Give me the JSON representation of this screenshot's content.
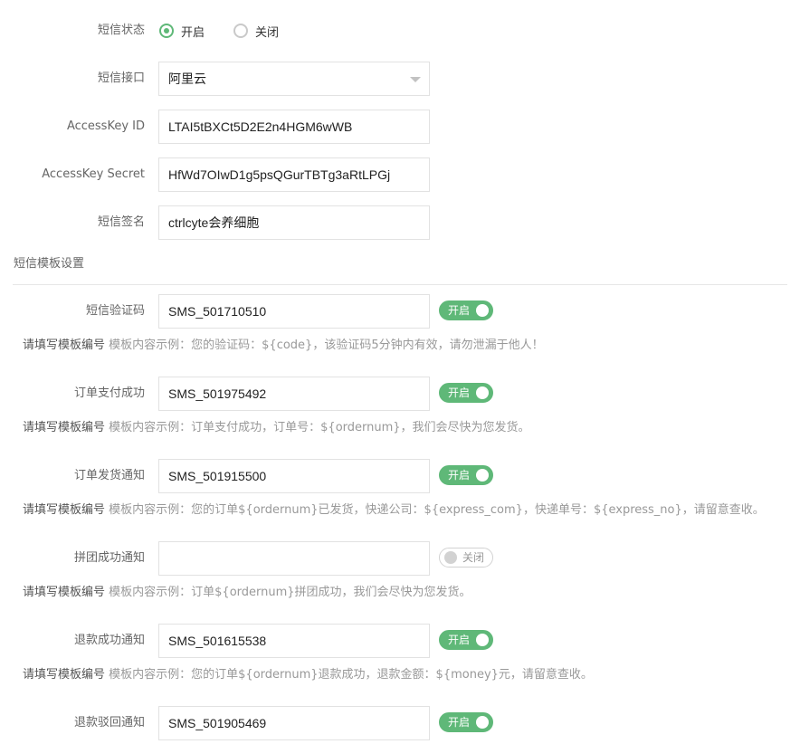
{
  "sms_status": {
    "label": "短信状态",
    "options": [
      {
        "label": "开启",
        "checked": true
      },
      {
        "label": "关闭",
        "checked": false
      }
    ]
  },
  "sms_provider": {
    "label": "短信接口",
    "value": "阿里云"
  },
  "access_key_id": {
    "label": "AccessKey ID",
    "value": "LTAI5tBXCt5D2E2n4HGM6wWB"
  },
  "access_key_secret": {
    "label": "AccessKey Secret",
    "value": "HfWd7OIwD1g5psQGurTBTg3aRtLPGj"
  },
  "sms_signature": {
    "label": "短信签名",
    "value": "ctrlcyte会养细胞"
  },
  "template_section_title": "短信模板设置",
  "hint_prefix": "请填写模板编号",
  "templates": [
    {
      "label": "短信验证码",
      "value": "SMS_501710510",
      "enabled": true,
      "toggle_text": "开启",
      "hint": "模板内容示例：您的验证码：${code}，该验证码5分钟内有效，请勿泄漏于他人！"
    },
    {
      "label": "订单支付成功",
      "value": "SMS_501975492",
      "enabled": true,
      "toggle_text": "开启",
      "hint": "模板内容示例：订单支付成功，订单号：${ordernum}，我们会尽快为您发货。"
    },
    {
      "label": "订单发货通知",
      "value": "SMS_501915500",
      "enabled": true,
      "toggle_text": "开启",
      "hint": "模板内容示例：您的订单${ordernum}已发货，快递公司：${express_com}，快递单号：${express_no}，请留意查收。"
    },
    {
      "label": "拼团成功通知",
      "value": "",
      "enabled": false,
      "toggle_text": "关闭",
      "hint": "模板内容示例：订单${ordernum}拼团成功，我们会尽快为您发货。"
    },
    {
      "label": "退款成功通知",
      "value": "SMS_501615538",
      "enabled": true,
      "toggle_text": "开启",
      "hint": "模板内容示例：您的订单${ordernum}退款成功，退款金额：${money}元，请留意查收。"
    },
    {
      "label": "退款驳回通知",
      "value": "SMS_501905469",
      "enabled": true,
      "toggle_text": "开启"
    }
  ],
  "colors": {
    "accent": "#5fb878",
    "border": "#e2e2e2",
    "muted": "#999999"
  }
}
